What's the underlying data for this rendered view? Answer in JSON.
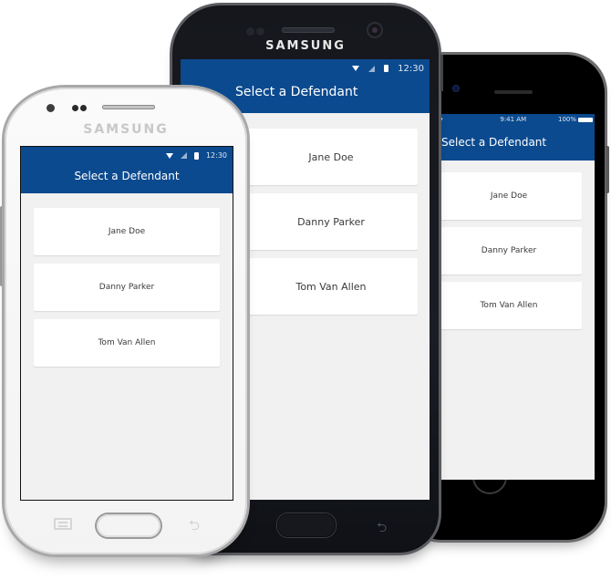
{
  "colors": {
    "app_bar": "#0b4a8f",
    "screen_bg": "#f1f1f1",
    "card_bg": "#ffffff",
    "card_text": "#3a3a3a"
  },
  "phones": {
    "iphone": {
      "status": {
        "time": "9:41 AM",
        "battery": "100%",
        "icons": [
          "wifi-icon",
          "battery-icon"
        ]
      },
      "title": "Select a Defendant",
      "defendants": [
        "Jane Doe",
        "Danny Parker",
        "Tom Van Allen"
      ]
    },
    "galaxy_s7": {
      "brand": "SAMSUNG",
      "status": {
        "time": "12:30",
        "icons": [
          "wifi-icon",
          "signal-icon",
          "battery-icon"
        ]
      },
      "title": "Select a Defendant",
      "defendants": [
        "Jane Doe",
        "Danny Parker",
        "Tom Van Allen"
      ]
    },
    "galaxy_white": {
      "brand": "SAMSUNG",
      "status": {
        "time": "12:30",
        "icons": [
          "wifi-icon",
          "signal-icon",
          "battery-icon"
        ]
      },
      "title": "Select a Defendant",
      "defendants": [
        "Jane Doe",
        "Danny Parker",
        "Tom Van Allen"
      ]
    }
  },
  "icons": {
    "back": "⮌"
  }
}
